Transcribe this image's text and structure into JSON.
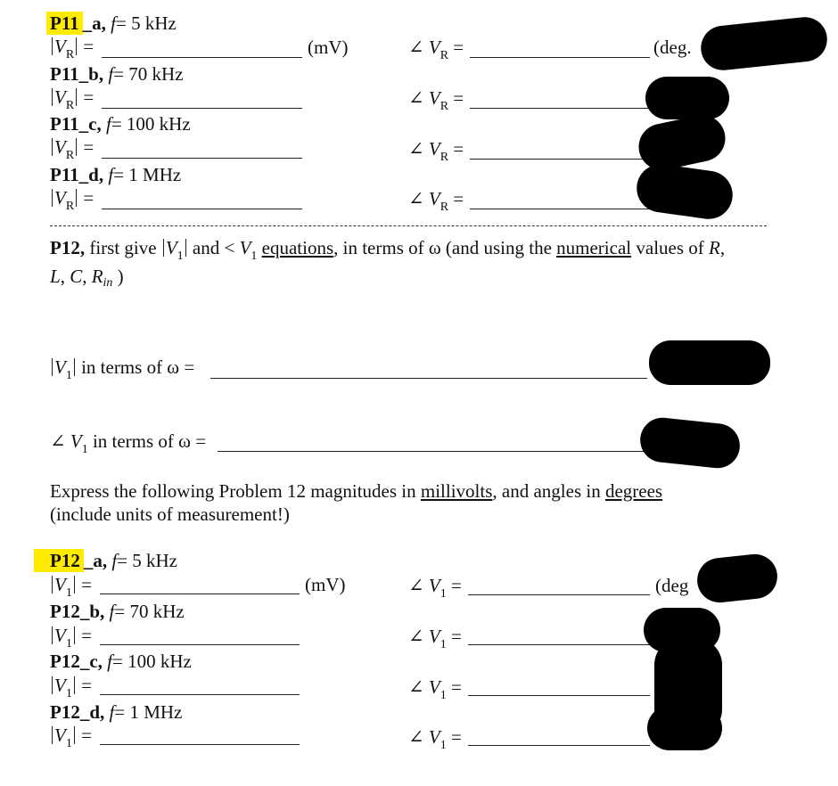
{
  "p11": {
    "parts": [
      {
        "id": "P11",
        "suffix": "a,",
        "f_label": "f",
        "freq": "= 5 kHz",
        "mag_label": "V",
        "mag_sub": "R",
        "ang_label": "V",
        "ang_sub": "R",
        "mag_unit": "(mV)",
        "ang_unit": "(deg."
      },
      {
        "id": "P11",
        "suffix": "_b,",
        "f_label": "f",
        "freq": "= 70 kHz",
        "mag_label": "V",
        "mag_sub": "R",
        "ang_label": "V",
        "ang_sub": "R"
      },
      {
        "id": "P11",
        "suffix": "_c,",
        "f_label": "f",
        "freq": "= 100 kHz",
        "mag_label": "V",
        "mag_sub": "R",
        "ang_label": "V",
        "ang_sub": "R"
      },
      {
        "id": "P11",
        "suffix": "_d,",
        "f_label": "f",
        "freq": "= 1 MHz",
        "mag_label": "V",
        "mag_sub": "R",
        "ang_label": "V",
        "ang_sub": "R"
      }
    ],
    "first_underscore": "_",
    "eq": "=",
    "angle_symbol": "∠"
  },
  "p12_intro": {
    "lead": "P12,",
    "t1": " first give ",
    "v": "V",
    "sub": "1",
    "t2": " and < ",
    "t3": "equations",
    "t4": ", in terms of ω (and using the ",
    "t5": "numerical",
    "t6": " values of ",
    "r": "R",
    "t7": ",",
    "line2_L": "L",
    "line2_sep1": ", ",
    "line2_C": "C",
    "line2_sep2": ", ",
    "line2_R": "R",
    "line2_Rsub": "in",
    "line2_end": " )"
  },
  "eq_lines": {
    "mag_label": " in terms of ω =",
    "ang_label": " in terms of ω ="
  },
  "instructions": {
    "t1": "Express the following Problem 12 magnitudes in ",
    "u1": "millivolts",
    "t2": ", and angles in ",
    "u2": "degrees",
    "line2": "(include units of measurement!)"
  },
  "p12": {
    "parts": [
      {
        "id": "P12",
        "suffix": "_a,",
        "freq": "= 5 kHz",
        "mag_unit": "(mV)",
        "ang_unit": "(deg"
      },
      {
        "id": "P12",
        "suffix": "_b,",
        "freq": "= 70 kHz"
      },
      {
        "id": "P12",
        "suffix": "_c,",
        "freq": "= 100 kHz"
      },
      {
        "id": "P12",
        "suffix": "_d,",
        "freq": "= 1 MHz"
      }
    ],
    "v": "V",
    "sub": "1"
  },
  "colors": {
    "highlight": "#ffeb00",
    "redaction": "#000000"
  }
}
